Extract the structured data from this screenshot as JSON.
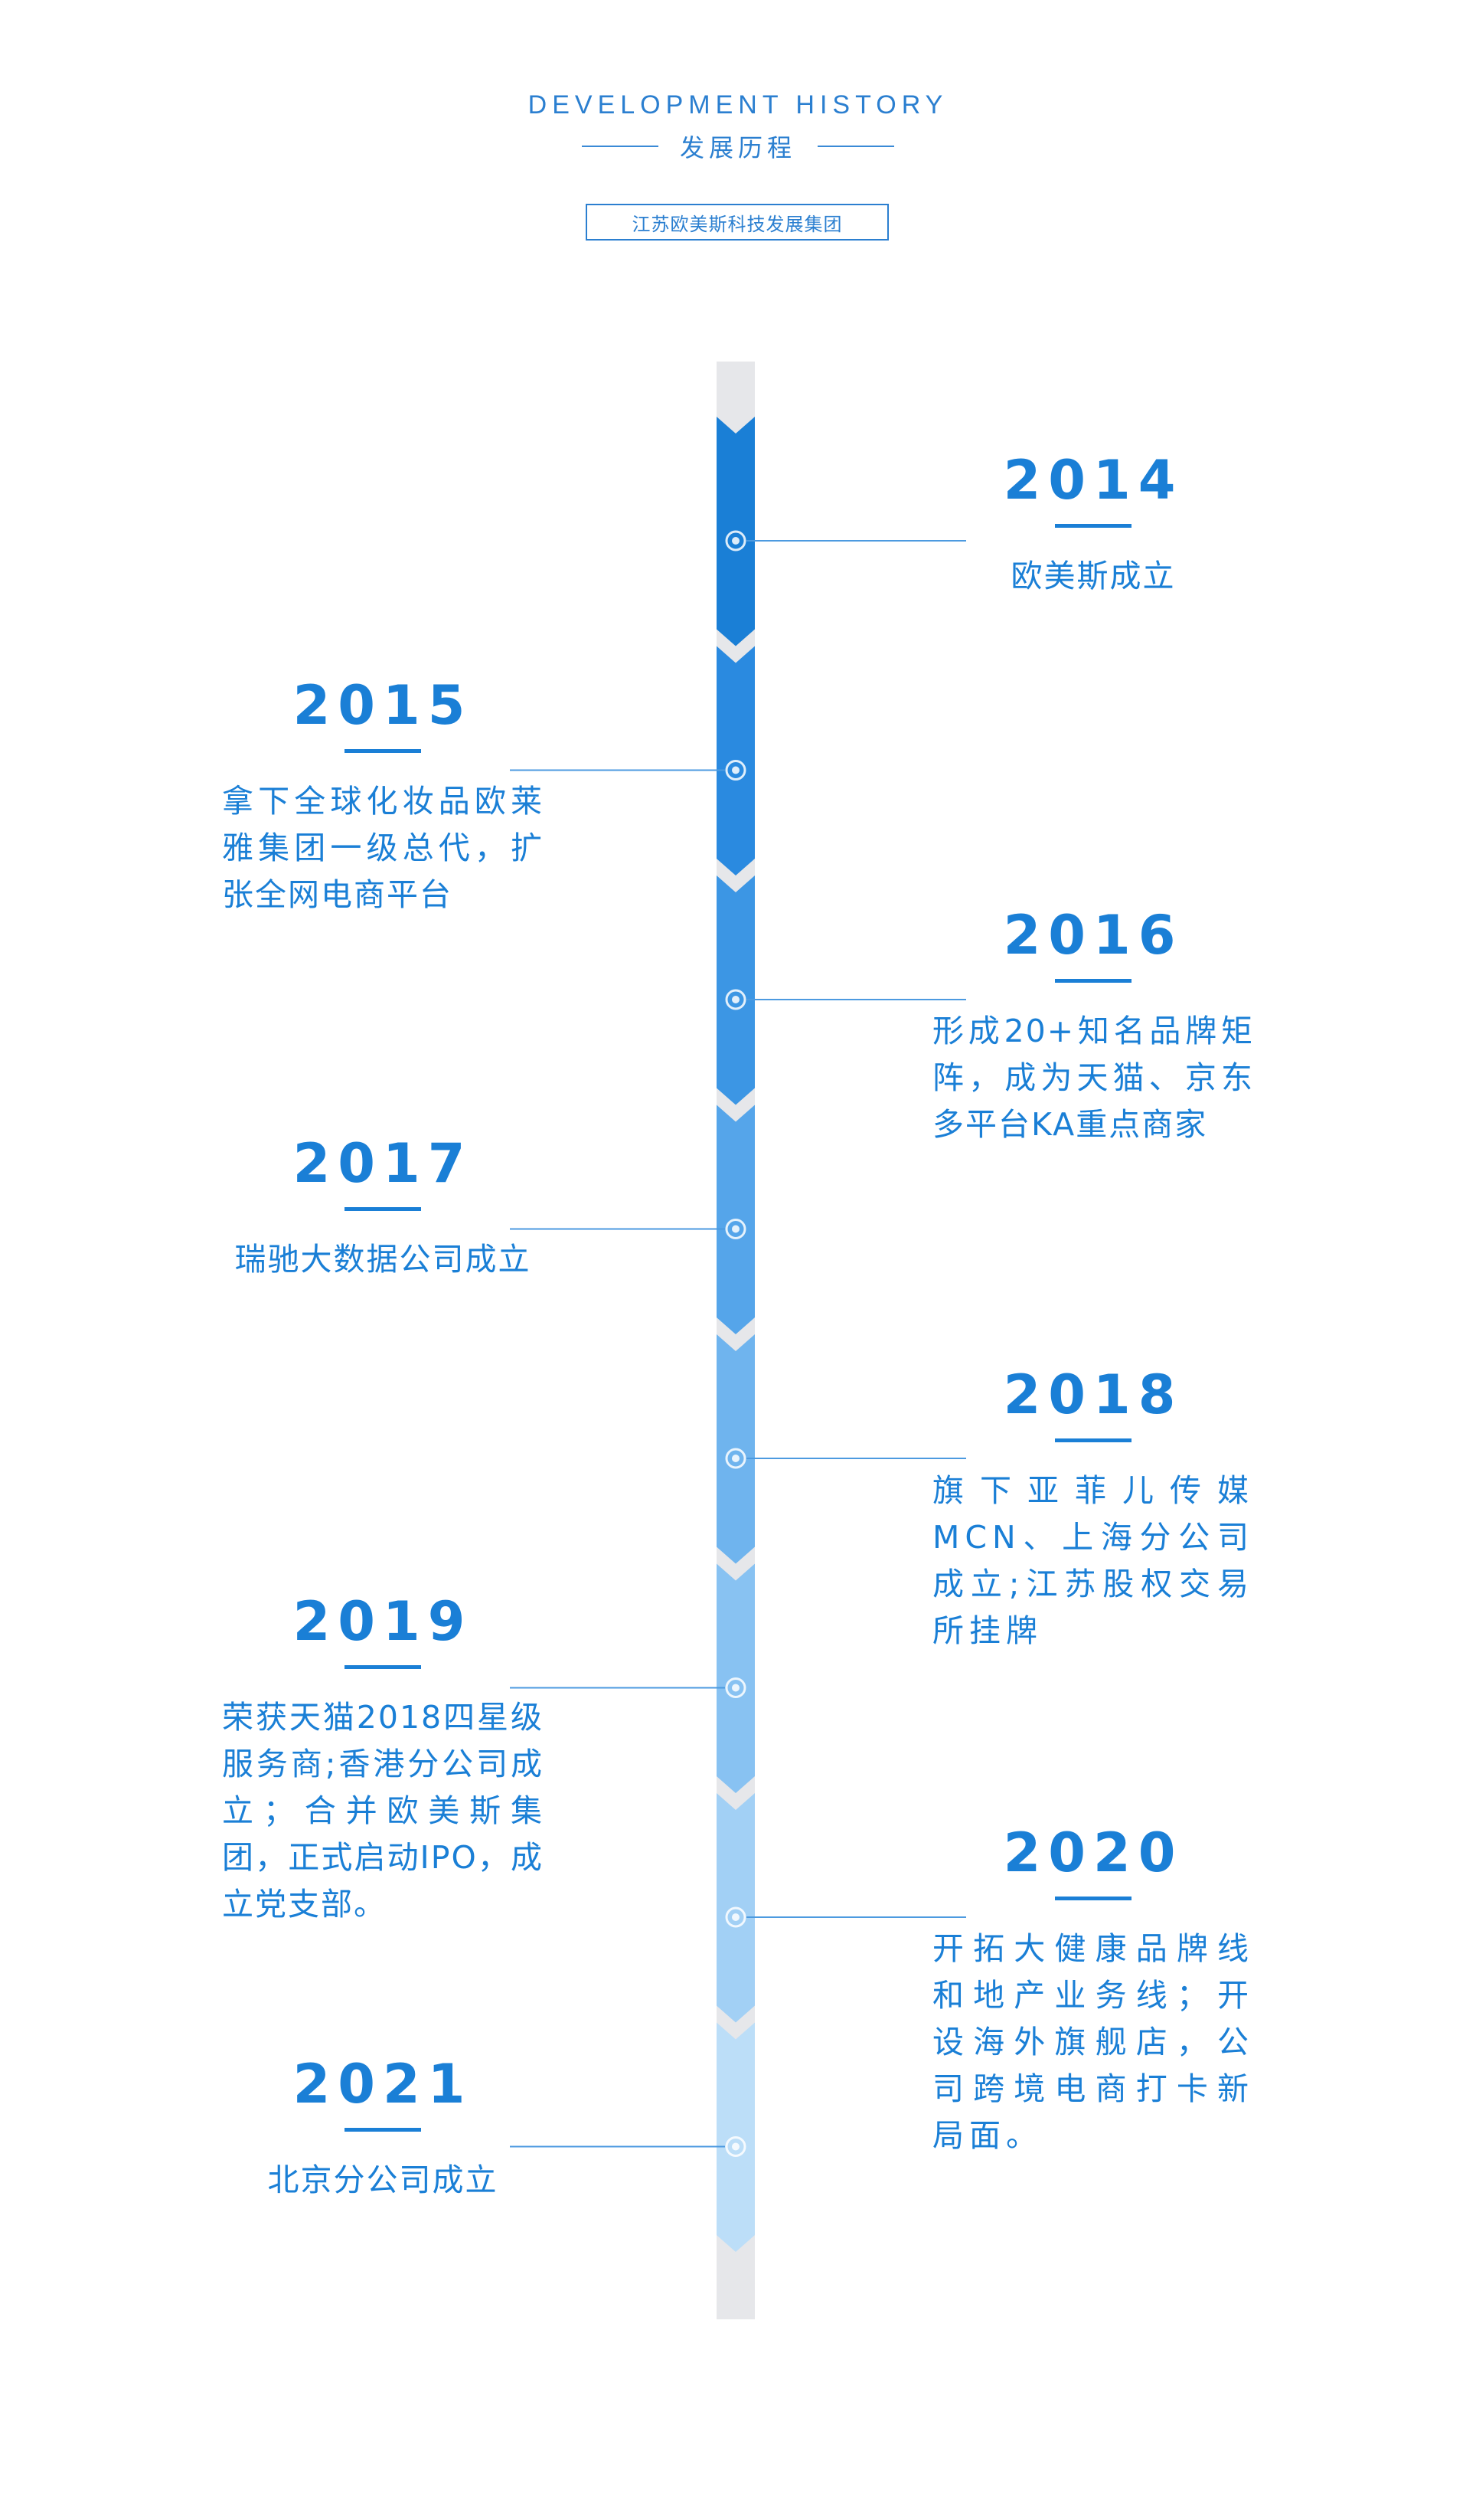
{
  "header": {
    "title_en": "DEVELOPMENT HISTORY",
    "title_cn": "发展历程",
    "company": "江苏欧美斯科技发展集团"
  },
  "colors": {
    "accent": "#1a7fd6",
    "track_gray": "#e6e7ea",
    "segments": [
      "#1a7fd6",
      "#2a8ae0",
      "#3c96e4",
      "#55a5ea",
      "#6fb4ee",
      "#88c2f2",
      "#a2d0f5",
      "#bcdef8"
    ]
  },
  "timeline": {
    "events": [
      {
        "year": "2014",
        "side": "right",
        "text": "欧美斯成立"
      },
      {
        "year": "2015",
        "side": "left",
        "text": "拿下全球化妆品欧莱雅集团一级总代，扩张全网电商平台"
      },
      {
        "year": "2016",
        "side": "right",
        "text": "形成20+知名品牌矩阵，成为天猫、京东多平台KA重点商家"
      },
      {
        "year": "2017",
        "side": "left",
        "text": "瑞驰大数据公司成立"
      },
      {
        "year": "2018",
        "side": "right",
        "text": "旗下亚菲儿传媒MCN、上海分公司成立;江苏股权交易所挂牌"
      },
      {
        "year": "2019",
        "side": "left",
        "text": "荣获天猫2018四星级服务商;香港分公司成立；合并欧美斯集团，正式启动IPO，成立党支部。"
      },
      {
        "year": "2020",
        "side": "right",
        "text": "开拓大健康品牌线和地产业务线；开设海外旗舰店，公司跨境电商打卡新局面。"
      },
      {
        "year": "2021",
        "side": "left",
        "text": "北京分公司成立"
      }
    ]
  }
}
